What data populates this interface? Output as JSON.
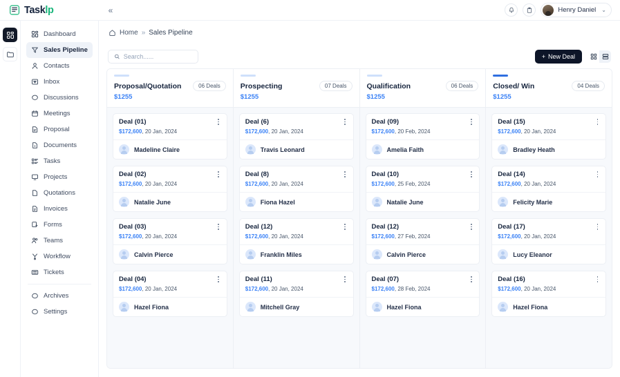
{
  "app": {
    "logo_text_main": "Task",
    "logo_text_accent": "lp",
    "logo_icon": "taskip-logo-icon",
    "collapse_icon": "«"
  },
  "topbar": {
    "notification_icon": "bell-icon",
    "clipboard_icon": "clipboard-icon",
    "user_name": "Henry Daniel",
    "chevron": "⌄"
  },
  "rail": {
    "items": [
      {
        "name": "apps-grid-icon",
        "active": true
      },
      {
        "name": "folder-icon",
        "active": false
      }
    ]
  },
  "sidebar": {
    "items": [
      {
        "label": "Dashboard",
        "icon": "dashboard-icon",
        "active": false
      },
      {
        "label": "Sales Pipeline",
        "icon": "funnel-icon",
        "active": true
      },
      {
        "label": "Contacts",
        "icon": "person-icon",
        "active": false
      },
      {
        "label": "Inbox",
        "icon": "inbox-icon",
        "active": false
      },
      {
        "label": "Discussions",
        "icon": "chat-bubble-icon",
        "active": false
      },
      {
        "label": "Meetings",
        "icon": "calendar-icon",
        "active": false
      },
      {
        "label": "Proposal",
        "icon": "proposal-doc-icon",
        "active": false
      },
      {
        "label": "Documents",
        "icon": "document-icon",
        "active": false
      },
      {
        "label": "Tasks",
        "icon": "tasks-list-icon",
        "active": false
      },
      {
        "label": "Projects",
        "icon": "projects-screen-icon",
        "active": false
      },
      {
        "label": "Quotations",
        "icon": "quotation-page-icon",
        "active": false
      },
      {
        "label": "Invoices",
        "icon": "invoice-icon",
        "active": false
      },
      {
        "label": "Forms",
        "icon": "forms-icon",
        "active": false
      },
      {
        "label": "Teams",
        "icon": "teams-icon",
        "active": false
      },
      {
        "label": "Workflow",
        "icon": "workflow-icon",
        "active": false
      },
      {
        "label": "Tickets",
        "icon": "ticket-icon",
        "active": false
      }
    ],
    "footer_items": [
      {
        "label": "Archives",
        "icon": "archive-circle-icon"
      },
      {
        "label": "Settings",
        "icon": "settings-circle-icon"
      }
    ]
  },
  "breadcrumb": {
    "home_icon": "home-icon",
    "home": "Home",
    "separator": "»",
    "current": "Sales Pipeline"
  },
  "toolbar": {
    "search_placeholder": "Search......",
    "search_value": "",
    "search_icon": "search-icon",
    "new_deal_label": "New Deal",
    "new_deal_icon": "plus-icon",
    "view_grid_icon": "grid-view-icon",
    "view_list_icon": "list-view-icon"
  },
  "colors": {
    "accent_blue": "#3b82f6",
    "bar_light": "#cfe0fb",
    "bar_dark": "#2f6fe0",
    "button_dark": "#0d1528",
    "brand_green": "#18b57a"
  },
  "board": {
    "columns": [
      {
        "title": "Proposal/Quotation",
        "count": "06 Deals",
        "amount": "$1255",
        "bar_color": "#cfe0fb",
        "cards": [
          {
            "name": "Deal (01)",
            "amount": "$172,600",
            "date": "20 Jan, 2024",
            "contact": "Madeline Claire"
          },
          {
            "name": "Deal (02)",
            "amount": "$172,600",
            "date": "20 Jan, 2024",
            "contact": "Natalie June"
          },
          {
            "name": "Deal (03)",
            "amount": "$172,600",
            "date": "20 Jan, 2024",
            "contact": "Calvin Pierce"
          },
          {
            "name": "Deal (04)",
            "amount": "$172,600",
            "date": "20 Jan, 2024",
            "contact": "Hazel Fiona"
          }
        ]
      },
      {
        "title": "Prospecting",
        "count": "07 Deals",
        "amount": "$1255",
        "bar_color": "#cfe0fb",
        "cards": [
          {
            "name": "Deal (6)",
            "amount": "$172,600",
            "date": "20 Jan, 2024",
            "contact": "Travis Leonard"
          },
          {
            "name": "Deal (8)",
            "amount": "$172,600",
            "date": "20 Jan, 2024",
            "contact": "Fiona Hazel"
          },
          {
            "name": "Deal (12)",
            "amount": "$172,600",
            "date": "20 Jan, 2024",
            "contact": "Franklin Miles"
          },
          {
            "name": "Deal (11)",
            "amount": "$172,600",
            "date": "20 Jan, 2024",
            "contact": "Mitchell Gray"
          }
        ]
      },
      {
        "title": "Qualification",
        "count": "06 Deals",
        "amount": "$1255",
        "bar_color": "#cfe0fb",
        "cards": [
          {
            "name": "Deal (09)",
            "amount": "$172,600",
            "date": "20 Feb, 2024",
            "contact": "Amelia Faith"
          },
          {
            "name": "Deal (10)",
            "amount": "$172,600",
            "date": "25 Feb, 2024",
            "contact": "Natalie June"
          },
          {
            "name": "Deal (12)",
            "amount": "$172,600",
            "date": "27 Feb, 2024",
            "contact": "Calvin Pierce"
          },
          {
            "name": "Deal (07)",
            "amount": "$172,600",
            "date": "28 Feb, 2024",
            "contact": "Hazel Fiona"
          }
        ]
      },
      {
        "title": "Closed/ Win",
        "count": "04 Deals",
        "amount": "$1255",
        "bar_color": "#2f6fe0",
        "cards": [
          {
            "name": "Deal (15)",
            "amount": "$172,600",
            "date": "20 Jan, 2024",
            "contact": "Bradley Heath"
          },
          {
            "name": "Deal (14)",
            "amount": "$172,600",
            "date": "20 Jan, 2024",
            "contact": "Felicity Marie"
          },
          {
            "name": "Deal (17)",
            "amount": "$172,600",
            "date": "20 Jan, 2024",
            "contact": "Lucy Eleanor"
          },
          {
            "name": "Deal (16)",
            "amount": "$172,600",
            "date": "20 Jan, 2024",
            "contact": "Hazel Fiona"
          }
        ]
      }
    ]
  }
}
